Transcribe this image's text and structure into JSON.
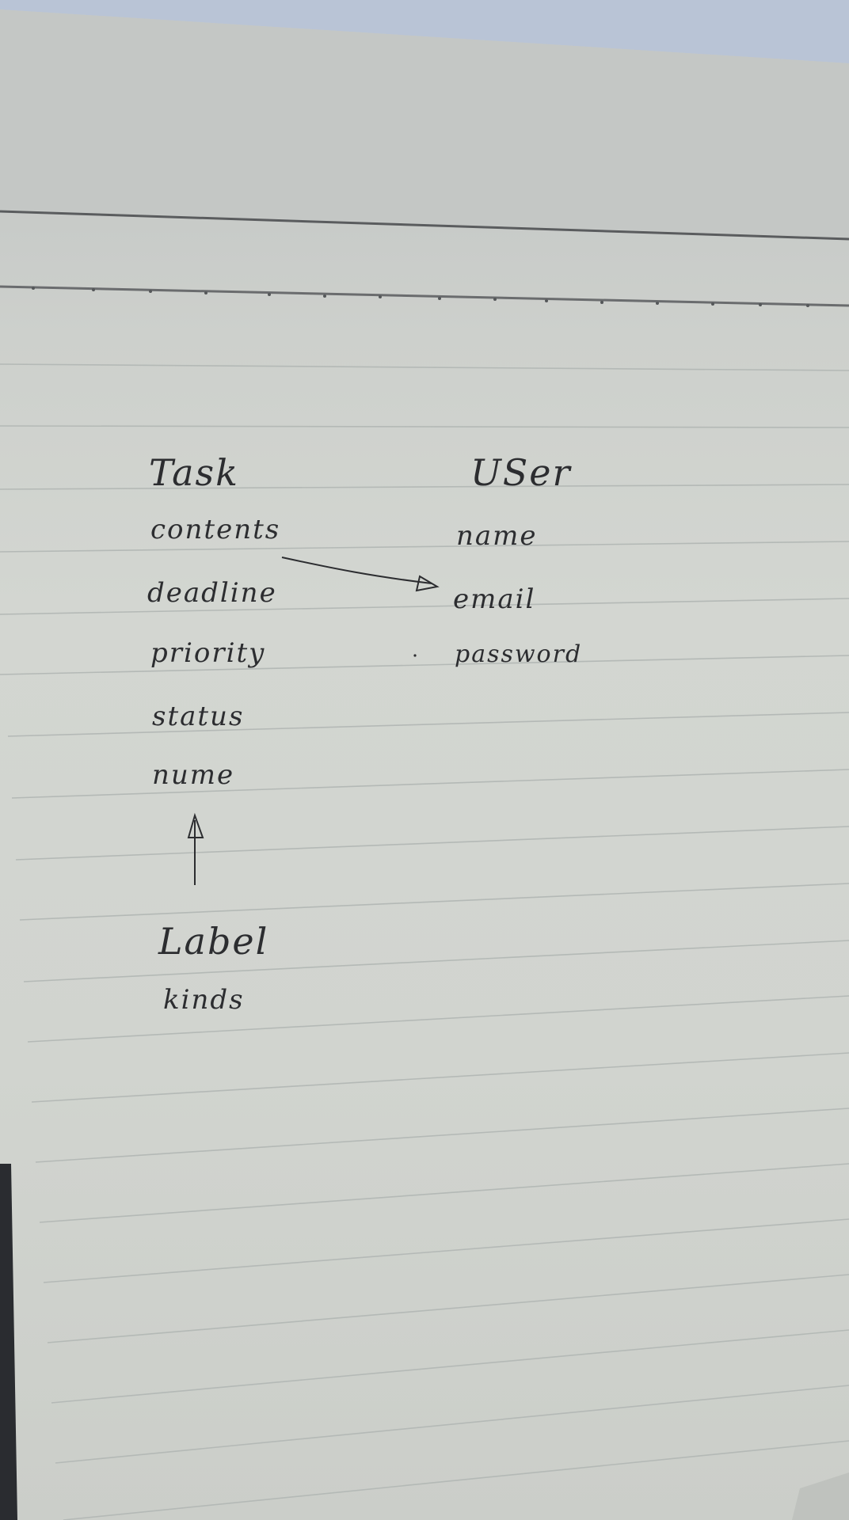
{
  "diagram": {
    "entities": [
      {
        "id": "task",
        "title": "Task",
        "fields": [
          "contents",
          "deadline",
          "priority",
          "status",
          "nume"
        ]
      },
      {
        "id": "user",
        "title": "USer",
        "fields": [
          "name",
          "email",
          "password"
        ]
      },
      {
        "id": "label",
        "title": "Label",
        "fields": [
          "kinds"
        ]
      }
    ],
    "relations": [
      {
        "from": "task.contents",
        "to": "user.email"
      },
      {
        "from": "label",
        "to": "task.nume"
      }
    ]
  },
  "colors": {
    "paper": "#d1d4cf",
    "ink": "#2c2d30",
    "rule_line": "#b4b9b6",
    "header_line": "#5a5c5e",
    "background_top": "#b9c4d6",
    "shadow_left": "#2a2c30"
  }
}
